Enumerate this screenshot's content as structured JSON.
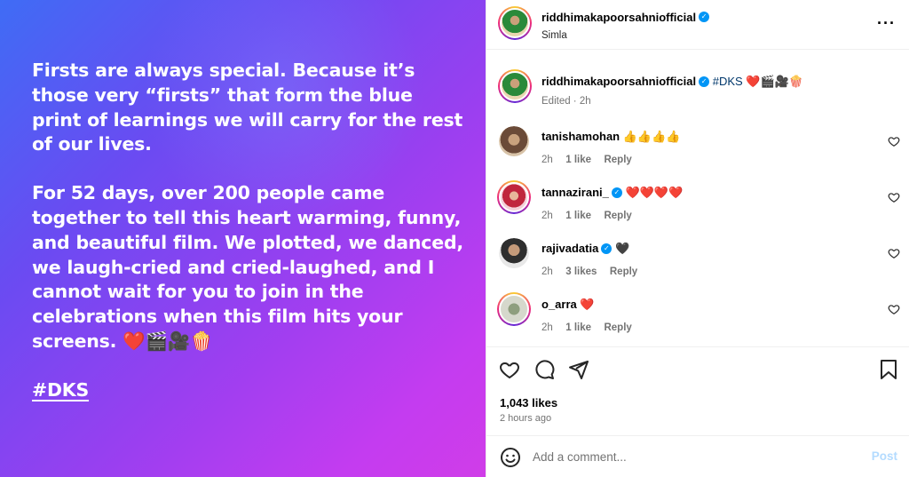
{
  "image": {
    "paragraph1": "Firsts are always special. Because it’s\nthose very “firsts” that form the blue\nprint of learnings we will carry for the rest\nof our lives.",
    "paragraph2": "For 52 days, over 200 people came\ntogether to tell this heart warming, funny,\nand beautiful film.  We plotted, we danced,\nwe laugh-cried and cried-laughed, and I\ncannot wait for you to join in the\ncelebrations when this film hits your\nscreens. ❤️🎬🎥🍿",
    "hashtag": "#DKS"
  },
  "header": {
    "username": "riddhimakapoorsahniofficial",
    "location": "Simla"
  },
  "caption": {
    "username": "riddhimakapoorsahniofficial",
    "hashtag": "#DKS",
    "emojis": "❤️🎬🎥🍿",
    "meta": "Edited · 2h"
  },
  "comments": [
    {
      "username": "tanishamohan",
      "text": "👍👍👍👍",
      "time": "2h",
      "likes": "1 like",
      "reply": "Reply",
      "verified": false
    },
    {
      "username": "tannazirani_",
      "text": "❤️❤️❤️❤️",
      "time": "2h",
      "likes": "1 like",
      "reply": "Reply",
      "verified": true
    },
    {
      "username": "rajivadatia",
      "text": "🖤",
      "time": "2h",
      "likes": "3 likes",
      "reply": "Reply",
      "verified": true
    },
    {
      "username": "o_arra",
      "text": "❤️",
      "time": "2h",
      "likes": "1 like",
      "reply": "Reply",
      "verified": false
    }
  ],
  "stats": {
    "likes": "1,043 likes",
    "time_ago": "2 hours ago"
  },
  "comment_box": {
    "placeholder": "Add a comment...",
    "post_label": "Post"
  },
  "colors": {
    "verified": "#0095f6",
    "gradient_start": "#3f6cf5",
    "gradient_end": "#d03de8",
    "post_disabled": "#b3dbff"
  }
}
